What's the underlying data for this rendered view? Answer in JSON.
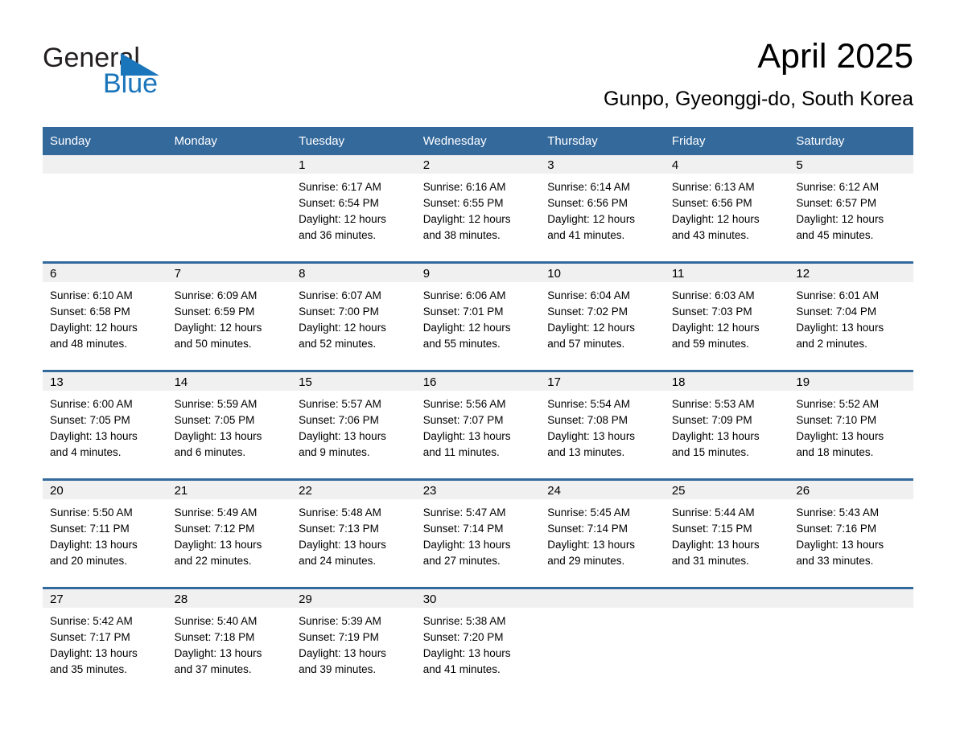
{
  "brand": {
    "name_part1": "General",
    "name_part2": "Blue",
    "accent_color": "#1b75bb",
    "triangle_icon": "triangle-icon"
  },
  "header": {
    "month_title": "April 2025",
    "location": "Gunpo, Gyeonggi-do, South Korea"
  },
  "calendar": {
    "header_bg": "#34699c",
    "daynum_bg": "#f0f0f0",
    "weekday_headers": [
      "Sunday",
      "Monday",
      "Tuesday",
      "Wednesday",
      "Thursday",
      "Friday",
      "Saturday"
    ],
    "weeks": [
      [
        {
          "day": "",
          "sunrise": "",
          "sunset": "",
          "daylight1": "",
          "daylight2": ""
        },
        {
          "day": "",
          "sunrise": "",
          "sunset": "",
          "daylight1": "",
          "daylight2": ""
        },
        {
          "day": "1",
          "sunrise": "Sunrise: 6:17 AM",
          "sunset": "Sunset: 6:54 PM",
          "daylight1": "Daylight: 12 hours",
          "daylight2": "and 36 minutes."
        },
        {
          "day": "2",
          "sunrise": "Sunrise: 6:16 AM",
          "sunset": "Sunset: 6:55 PM",
          "daylight1": "Daylight: 12 hours",
          "daylight2": "and 38 minutes."
        },
        {
          "day": "3",
          "sunrise": "Sunrise: 6:14 AM",
          "sunset": "Sunset: 6:56 PM",
          "daylight1": "Daylight: 12 hours",
          "daylight2": "and 41 minutes."
        },
        {
          "day": "4",
          "sunrise": "Sunrise: 6:13 AM",
          "sunset": "Sunset: 6:56 PM",
          "daylight1": "Daylight: 12 hours",
          "daylight2": "and 43 minutes."
        },
        {
          "day": "5",
          "sunrise": "Sunrise: 6:12 AM",
          "sunset": "Sunset: 6:57 PM",
          "daylight1": "Daylight: 12 hours",
          "daylight2": "and 45 minutes."
        }
      ],
      [
        {
          "day": "6",
          "sunrise": "Sunrise: 6:10 AM",
          "sunset": "Sunset: 6:58 PM",
          "daylight1": "Daylight: 12 hours",
          "daylight2": "and 48 minutes."
        },
        {
          "day": "7",
          "sunrise": "Sunrise: 6:09 AM",
          "sunset": "Sunset: 6:59 PM",
          "daylight1": "Daylight: 12 hours",
          "daylight2": "and 50 minutes."
        },
        {
          "day": "8",
          "sunrise": "Sunrise: 6:07 AM",
          "sunset": "Sunset: 7:00 PM",
          "daylight1": "Daylight: 12 hours",
          "daylight2": "and 52 minutes."
        },
        {
          "day": "9",
          "sunrise": "Sunrise: 6:06 AM",
          "sunset": "Sunset: 7:01 PM",
          "daylight1": "Daylight: 12 hours",
          "daylight2": "and 55 minutes."
        },
        {
          "day": "10",
          "sunrise": "Sunrise: 6:04 AM",
          "sunset": "Sunset: 7:02 PM",
          "daylight1": "Daylight: 12 hours",
          "daylight2": "and 57 minutes."
        },
        {
          "day": "11",
          "sunrise": "Sunrise: 6:03 AM",
          "sunset": "Sunset: 7:03 PM",
          "daylight1": "Daylight: 12 hours",
          "daylight2": "and 59 minutes."
        },
        {
          "day": "12",
          "sunrise": "Sunrise: 6:01 AM",
          "sunset": "Sunset: 7:04 PM",
          "daylight1": "Daylight: 13 hours",
          "daylight2": "and 2 minutes."
        }
      ],
      [
        {
          "day": "13",
          "sunrise": "Sunrise: 6:00 AM",
          "sunset": "Sunset: 7:05 PM",
          "daylight1": "Daylight: 13 hours",
          "daylight2": "and 4 minutes."
        },
        {
          "day": "14",
          "sunrise": "Sunrise: 5:59 AM",
          "sunset": "Sunset: 7:05 PM",
          "daylight1": "Daylight: 13 hours",
          "daylight2": "and 6 minutes."
        },
        {
          "day": "15",
          "sunrise": "Sunrise: 5:57 AM",
          "sunset": "Sunset: 7:06 PM",
          "daylight1": "Daylight: 13 hours",
          "daylight2": "and 9 minutes."
        },
        {
          "day": "16",
          "sunrise": "Sunrise: 5:56 AM",
          "sunset": "Sunset: 7:07 PM",
          "daylight1": "Daylight: 13 hours",
          "daylight2": "and 11 minutes."
        },
        {
          "day": "17",
          "sunrise": "Sunrise: 5:54 AM",
          "sunset": "Sunset: 7:08 PM",
          "daylight1": "Daylight: 13 hours",
          "daylight2": "and 13 minutes."
        },
        {
          "day": "18",
          "sunrise": "Sunrise: 5:53 AM",
          "sunset": "Sunset: 7:09 PM",
          "daylight1": "Daylight: 13 hours",
          "daylight2": "and 15 minutes."
        },
        {
          "day": "19",
          "sunrise": "Sunrise: 5:52 AM",
          "sunset": "Sunset: 7:10 PM",
          "daylight1": "Daylight: 13 hours",
          "daylight2": "and 18 minutes."
        }
      ],
      [
        {
          "day": "20",
          "sunrise": "Sunrise: 5:50 AM",
          "sunset": "Sunset: 7:11 PM",
          "daylight1": "Daylight: 13 hours",
          "daylight2": "and 20 minutes."
        },
        {
          "day": "21",
          "sunrise": "Sunrise: 5:49 AM",
          "sunset": "Sunset: 7:12 PM",
          "daylight1": "Daylight: 13 hours",
          "daylight2": "and 22 minutes."
        },
        {
          "day": "22",
          "sunrise": "Sunrise: 5:48 AM",
          "sunset": "Sunset: 7:13 PM",
          "daylight1": "Daylight: 13 hours",
          "daylight2": "and 24 minutes."
        },
        {
          "day": "23",
          "sunrise": "Sunrise: 5:47 AM",
          "sunset": "Sunset: 7:14 PM",
          "daylight1": "Daylight: 13 hours",
          "daylight2": "and 27 minutes."
        },
        {
          "day": "24",
          "sunrise": "Sunrise: 5:45 AM",
          "sunset": "Sunset: 7:14 PM",
          "daylight1": "Daylight: 13 hours",
          "daylight2": "and 29 minutes."
        },
        {
          "day": "25",
          "sunrise": "Sunrise: 5:44 AM",
          "sunset": "Sunset: 7:15 PM",
          "daylight1": "Daylight: 13 hours",
          "daylight2": "and 31 minutes."
        },
        {
          "day": "26",
          "sunrise": "Sunrise: 5:43 AM",
          "sunset": "Sunset: 7:16 PM",
          "daylight1": "Daylight: 13 hours",
          "daylight2": "and 33 minutes."
        }
      ],
      [
        {
          "day": "27",
          "sunrise": "Sunrise: 5:42 AM",
          "sunset": "Sunset: 7:17 PM",
          "daylight1": "Daylight: 13 hours",
          "daylight2": "and 35 minutes."
        },
        {
          "day": "28",
          "sunrise": "Sunrise: 5:40 AM",
          "sunset": "Sunset: 7:18 PM",
          "daylight1": "Daylight: 13 hours",
          "daylight2": "and 37 minutes."
        },
        {
          "day": "29",
          "sunrise": "Sunrise: 5:39 AM",
          "sunset": "Sunset: 7:19 PM",
          "daylight1": "Daylight: 13 hours",
          "daylight2": "and 39 minutes."
        },
        {
          "day": "30",
          "sunrise": "Sunrise: 5:38 AM",
          "sunset": "Sunset: 7:20 PM",
          "daylight1": "Daylight: 13 hours",
          "daylight2": "and 41 minutes."
        },
        {
          "day": "",
          "sunrise": "",
          "sunset": "",
          "daylight1": "",
          "daylight2": ""
        },
        {
          "day": "",
          "sunrise": "",
          "sunset": "",
          "daylight1": "",
          "daylight2": ""
        },
        {
          "day": "",
          "sunrise": "",
          "sunset": "",
          "daylight1": "",
          "daylight2": ""
        }
      ]
    ]
  }
}
